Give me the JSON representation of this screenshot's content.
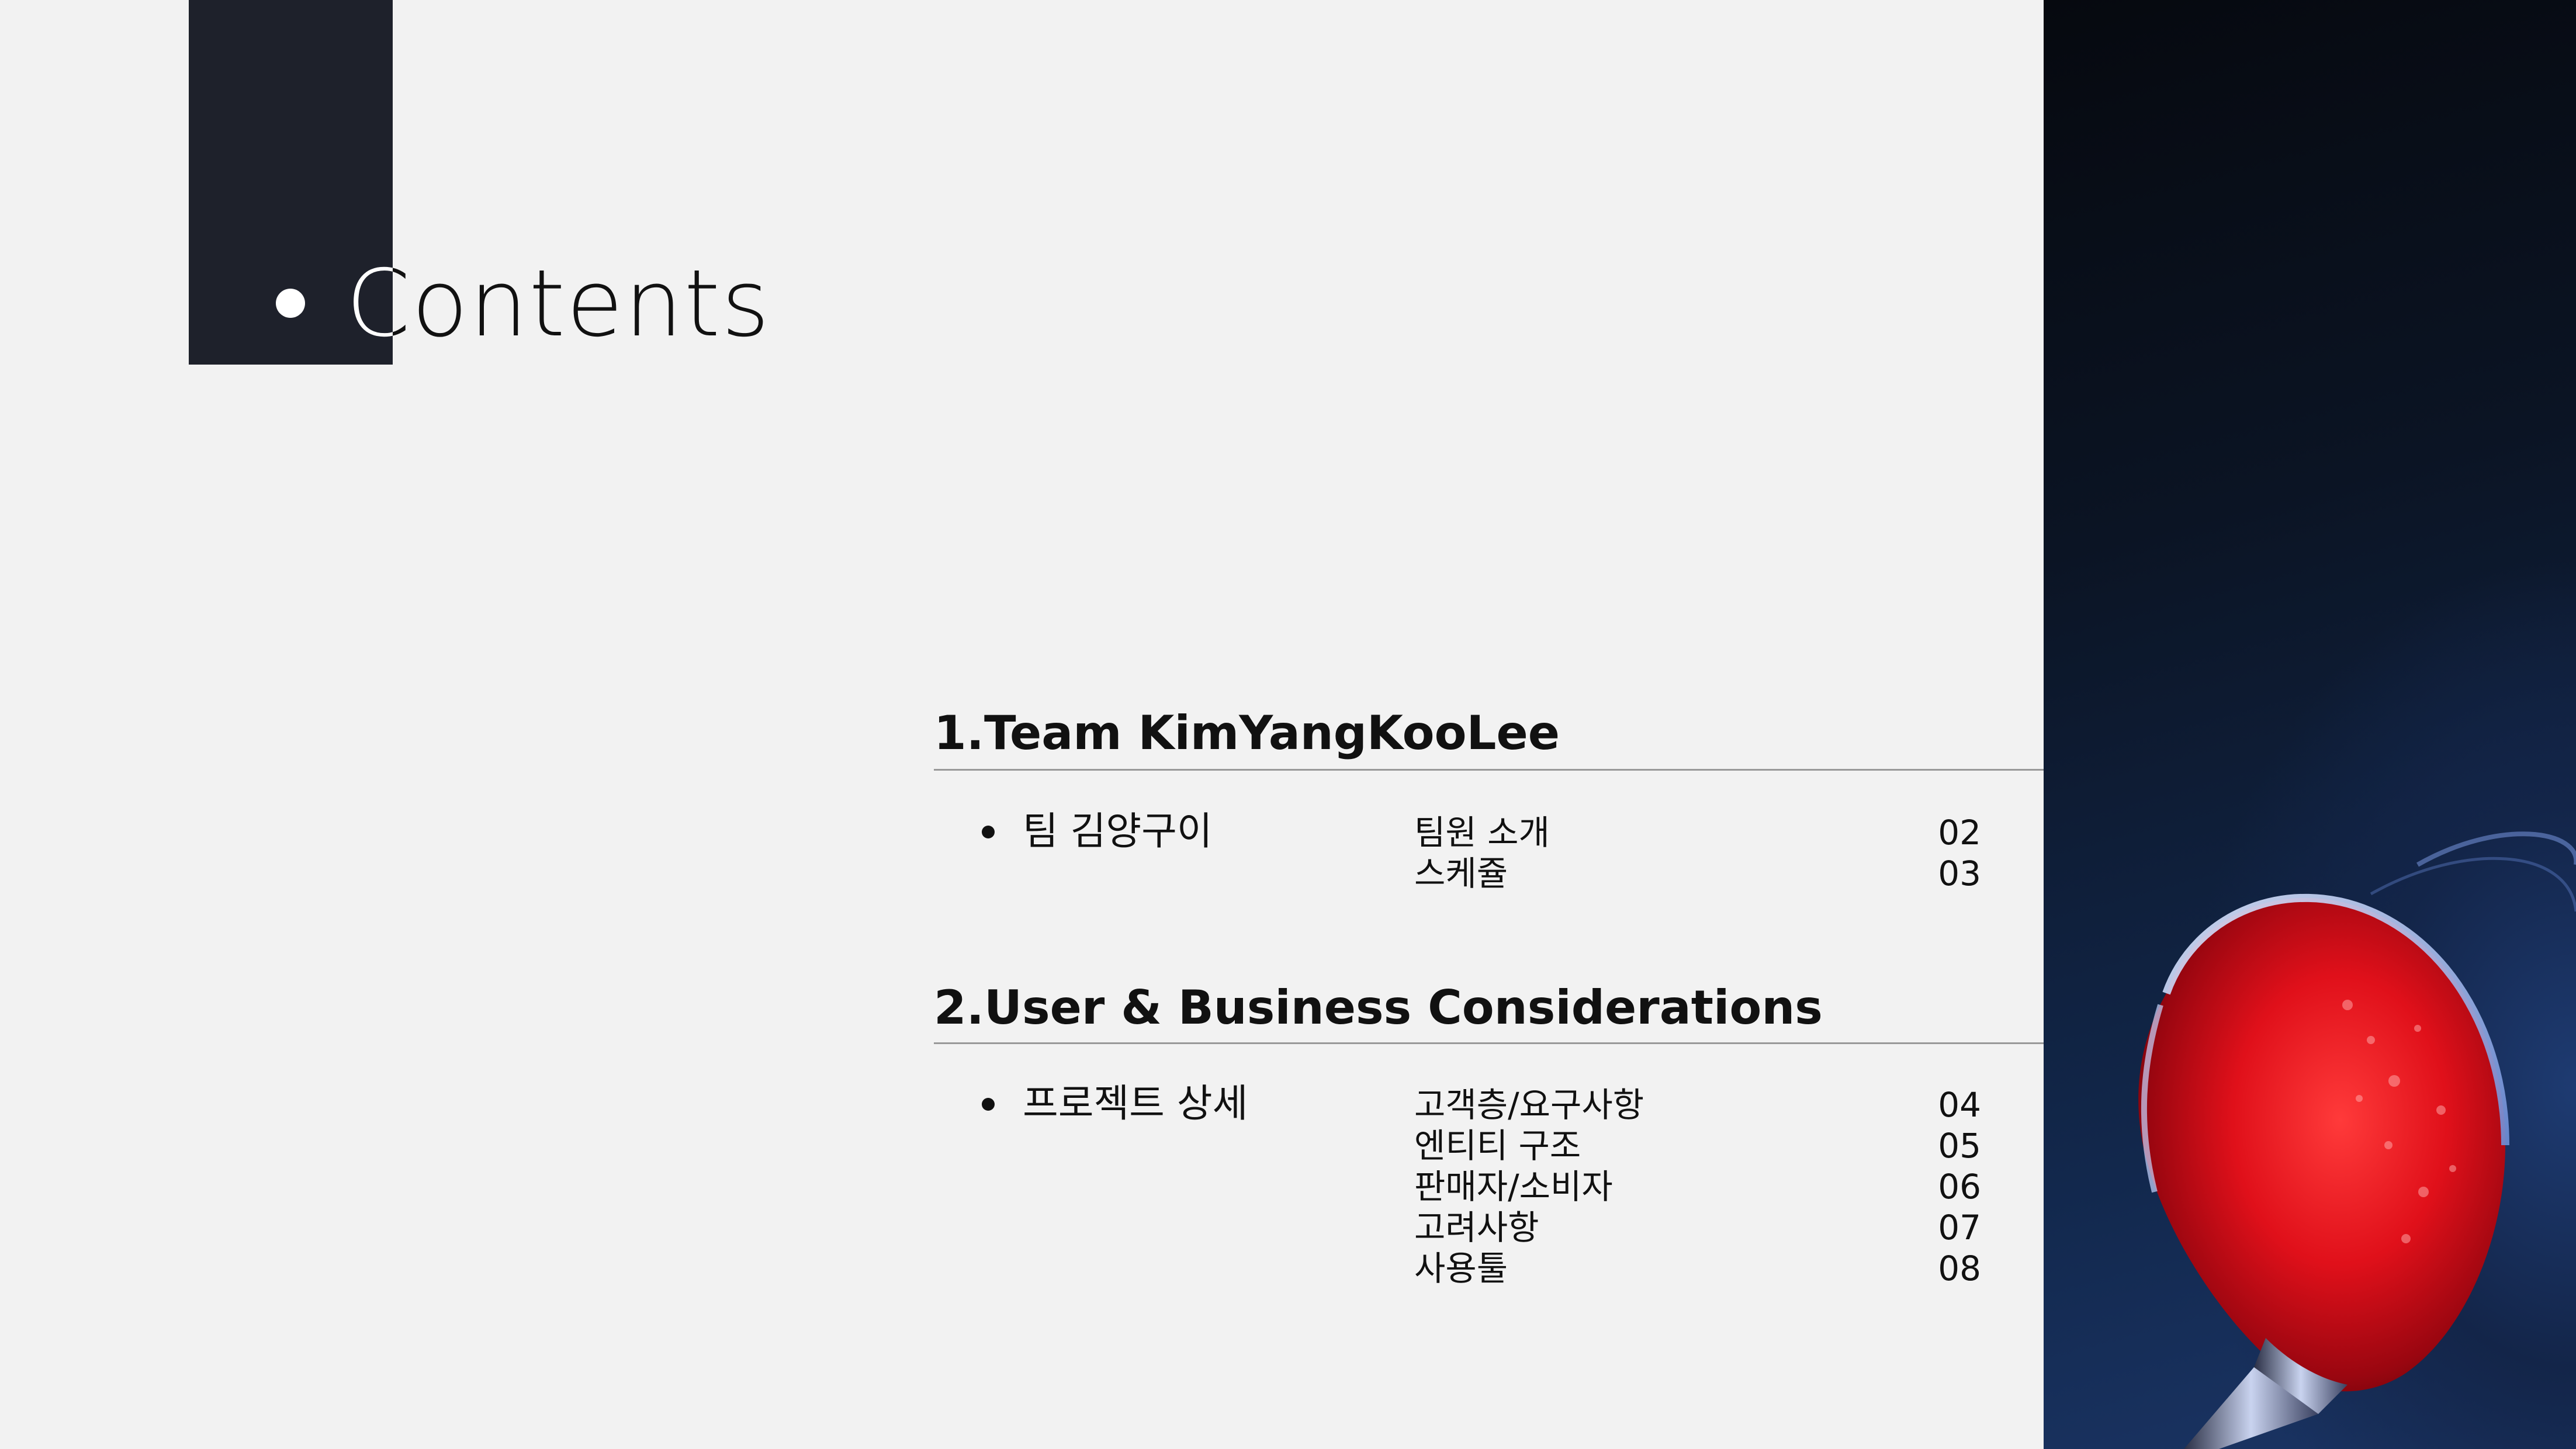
{
  "slide": {
    "title": "Contents",
    "sections": [
      {
        "heading": "1.Team KimYangKooLee",
        "topic": "팀 김양구이",
        "items": [
          "팀원 소개",
          "스케쥴"
        ],
        "pages": [
          "02",
          "03"
        ]
      },
      {
        "heading": "2.User & Business Considerations",
        "topic": "프로젝트 상세",
        "items": [
          "고객층/요구사항",
          "엔티티 구조",
          "판매자/소비자",
          "고려사항",
          "사용툴"
        ],
        "pages": [
          "04",
          "05",
          "06",
          "07",
          "08"
        ]
      }
    ]
  },
  "image": {
    "subject": "red-wine-glass-photo"
  },
  "colors": {
    "background": "#f2f2f2",
    "title_block": "#1e212b",
    "rule": "#999999"
  }
}
